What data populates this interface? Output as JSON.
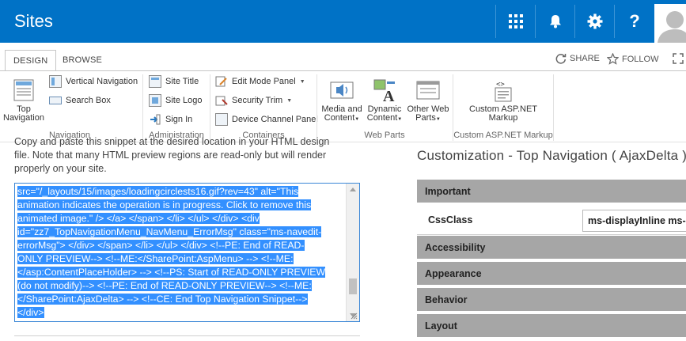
{
  "suitebar": {
    "title": "Sites",
    "buttons": [
      "app-launcher-icon",
      "bell-icon",
      "gear-icon",
      "help-icon"
    ],
    "help_label": "?"
  },
  "tabs": {
    "design": "DESIGN",
    "browse": "BROWSE",
    "share": "SHARE",
    "follow": "FOLLOW"
  },
  "ribbon": {
    "navigation": {
      "top_navigation_line1": "Top",
      "top_navigation_line2": "Navigation",
      "vertical_navigation": "Vertical Navigation",
      "search_box": "Search Box",
      "group_label": "Navigation"
    },
    "administration": {
      "site_title": "Site Title",
      "site_logo": "Site Logo",
      "sign_in": "Sign In",
      "group_label": "Administration"
    },
    "containers": {
      "edit_mode_panel": "Edit Mode Panel",
      "security_trim": "Security Trim",
      "device_channel_panel": "Device Channel Panel",
      "group_label": "Containers"
    },
    "web_parts": {
      "media_line1": "Media and",
      "media_line2": "Content",
      "dynamic_line1": "Dynamic",
      "dynamic_line2": "Content",
      "other_line1": "Other Web",
      "other_line2": "Parts",
      "group_label": "Web Parts"
    },
    "custom_markup": {
      "button_line1": "Custom ASP.NET",
      "button_line2": "Markup",
      "group_label": "Custom ASP.NET Markup"
    }
  },
  "snippet": {
    "intro": "Copy and paste this snippet at the desired location in your HTML design file. Note that many HTML preview regions are read-only but will render properly on your site.",
    "code_lines": [
      "src=\"/_layouts/15/images/loadingcirclests16.gif?rev=43\" alt=\"This",
      "animation indicates the operation is in progress. Click to remove this",
      "animated image.\" /> </a> </span> </li> </ul> </div> <div",
      "id=\"zz7_TopNavigationMenu_NavMenu_ErrorMsg\" class=\"ms-navedit-",
      "errorMsg\"> </div> </span> </li> </ul> </div> <!--PE: End of READ-",
      "ONLY PREVIEW--> <!--ME:</SharePoint:AspMenu> --> <!--ME:",
      "</asp:ContentPlaceHolder> --> <!--PS: Start of READ-ONLY PREVIEW",
      "(do not modify)--> <!--PE: End of READ-ONLY PREVIEW--> <!--ME:",
      "</SharePoint:AjaxDelta> --> <!--CE: End Top Navigation Snippet-->",
      "</div>"
    ]
  },
  "panel": {
    "title": "Customization - Top Navigation ( AjaxDelta )",
    "sections": {
      "important": "Important",
      "accessibility": "Accessibility",
      "appearance": "Appearance",
      "behavior": "Behavior",
      "layout": "Layout"
    },
    "cssclass_label": "CssClass",
    "cssclass_value": "ms-displayInline ms-core-navigation"
  }
}
